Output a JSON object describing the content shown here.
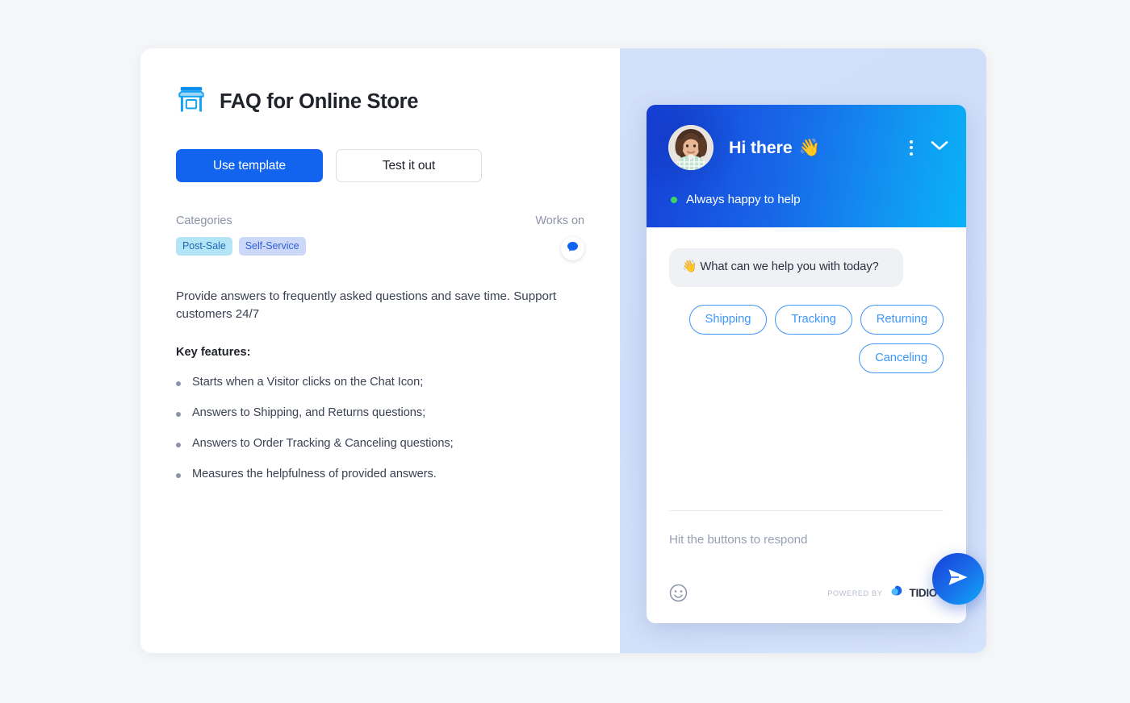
{
  "left": {
    "icon": "storefront-icon",
    "title": "FAQ for Online Store",
    "buttons": {
      "primary": "Use template",
      "secondary": "Test it out"
    },
    "categories_label": "Categories",
    "tags": [
      "Post-Sale",
      "Self-Service"
    ],
    "works_on_label": "Works on",
    "works_on_icon": "chat-bubble-icon",
    "description": "Provide answers to frequently asked questions and save time. Support customers 24/7",
    "key_features_label": "Key features:",
    "features": [
      "Starts when a Visitor clicks on the Chat Icon;",
      "Answers to Shipping, and Returns questions;",
      "Answers to Order Tracking & Canceling questions;",
      "Measures the helpfulness of provided answers."
    ]
  },
  "widget": {
    "avatar_alt": "agent-avatar",
    "greeting": "Hi there",
    "greeting_emoji": "👋",
    "menu_icon": "more-vertical-icon",
    "minimize_icon": "chevron-down-icon",
    "status": "Always happy to help",
    "status_color": "#3fd463",
    "message_emoji": "👋",
    "message": "What can we help you with today?",
    "quick_replies": [
      "Shipping",
      "Tracking",
      "Returning",
      "Canceling"
    ],
    "composer_placeholder": "Hit the buttons to respond",
    "emoji_icon": "smiley-icon",
    "powered_by": "POWERED BY",
    "brand": "TIDIO",
    "send_icon": "send-icon"
  },
  "colors": {
    "page_bg": "#f4f6f8",
    "accent": "#1264ef",
    "panel_bg": "#d3e0fa",
    "tag_postsale_bg": "#b3e5f7",
    "tag_selfservice_bg": "#ccd8f8",
    "quick_reply": "#3f97f8"
  }
}
